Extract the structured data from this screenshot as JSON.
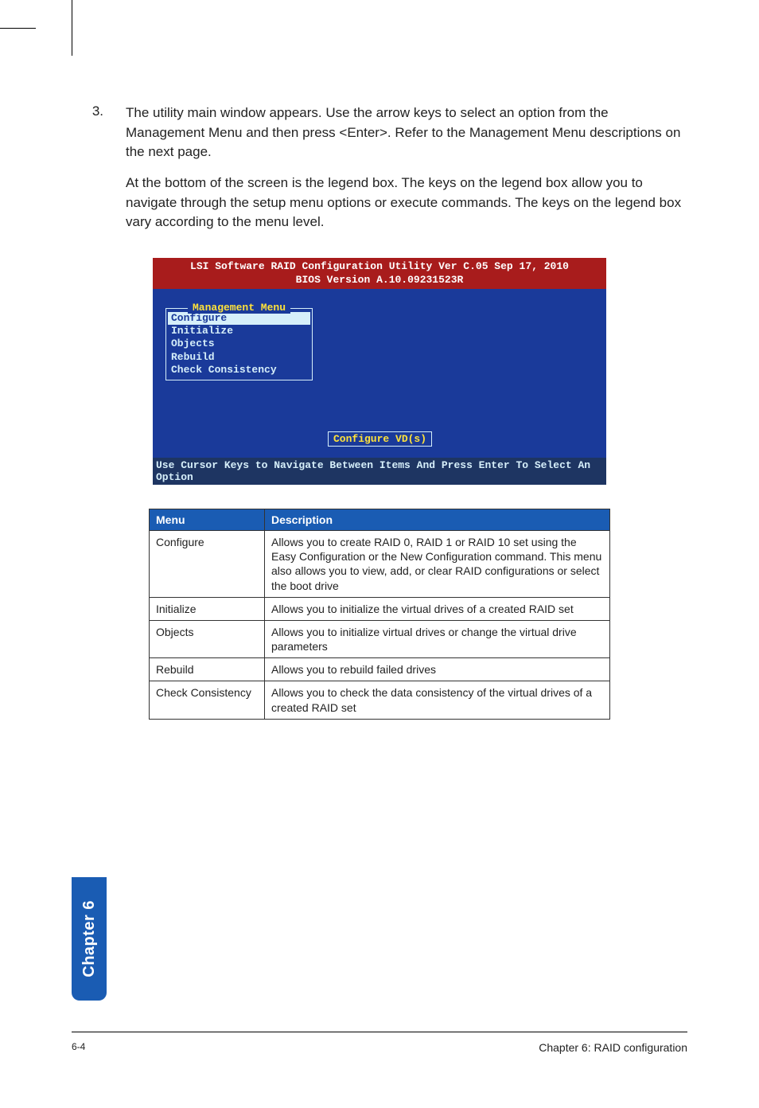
{
  "step": {
    "number": "3.",
    "para1": "The utility main window appears. Use the arrow keys to select an option from the Management Menu and then press <Enter>. Refer to the Management Menu descriptions on the next page.",
    "para2": "At the bottom of the screen is the legend box. The keys on the legend box allow you to navigate through the setup menu options or execute commands. The keys on the legend box vary according to the menu level."
  },
  "bios": {
    "header_line1": "LSI Software RAID Configuration Utility Ver C.05 Sep 17, 2010",
    "header_line2": "BIOS Version   A.10.09231523R",
    "mgmt_title": "Management Menu",
    "items": {
      "configure": "Configure",
      "initialize": "Initialize",
      "objects": "Objects",
      "rebuild": "Rebuild",
      "check": "Check Consistency"
    },
    "configure_vd": "Configure VD(s)",
    "legend": "Use Cursor Keys to Navigate Between Items And Press Enter To Select An Option"
  },
  "table": {
    "head_menu": "Menu",
    "head_desc": "Description",
    "rows": [
      {
        "menu": "Configure",
        "desc": "Allows you to create RAID 0, RAID 1 or RAID 10 set using the Easy Configuration or the New Configuration command. This menu also allows you to view, add, or clear RAID configurations or select the boot drive"
      },
      {
        "menu": "Initialize",
        "desc": "Allows you to initialize the virtual drives of a created RAID set"
      },
      {
        "menu": "Objects",
        "desc": "Allows you to initialize virtual drives or change the virtual drive parameters"
      },
      {
        "menu": "Rebuild",
        "desc": "Allows you to rebuild failed drives"
      },
      {
        "menu": "Check Consistency",
        "desc": "Allows you to check the data consistency of the virtual drives of a created RAID set"
      }
    ]
  },
  "chapter_tab": "Chapter 6",
  "footer": {
    "page_num": "6-4",
    "chapter_title": "Chapter 6: RAID configuration"
  }
}
